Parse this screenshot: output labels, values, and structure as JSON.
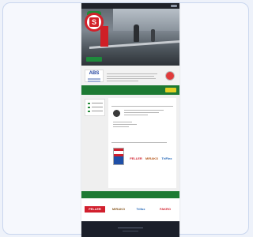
{
  "colors": {
    "brand_red": "#d3202a",
    "brand_green": "#1d7a33",
    "cta_yellow": "#e2cf24",
    "dark_footer": "#1b1f2a"
  },
  "header": {
    "logo_icon": "company-logo-icon",
    "search_icon": "search-icon"
  },
  "hero": {
    "tagline": "",
    "cta_label": ""
  },
  "intro": {
    "brand_mark": "ABS",
    "heading": "",
    "seal_icon": "award-seal-icon"
  },
  "greenbar": {
    "text": "",
    "button_label": ""
  },
  "main": {
    "section1_heading": "",
    "section2_heading": ""
  },
  "partners_band": {
    "text": ""
  },
  "partners": [
    {
      "name": "FELLER",
      "color": "#d11f2d"
    },
    {
      "name": "MIRAKO",
      "color": "#8a5a24"
    },
    {
      "name": "Trifox",
      "color": "#1e63b5"
    },
    {
      "name": "FAKRO",
      "color": "#d11f2d"
    }
  ],
  "brands_row": [
    {
      "name": "FELLER",
      "color": "#d11f2d"
    },
    {
      "name": "MIRAKO",
      "color": "#b5581c"
    },
    {
      "name": "TriFlex",
      "color": "#1e63b5"
    }
  ]
}
